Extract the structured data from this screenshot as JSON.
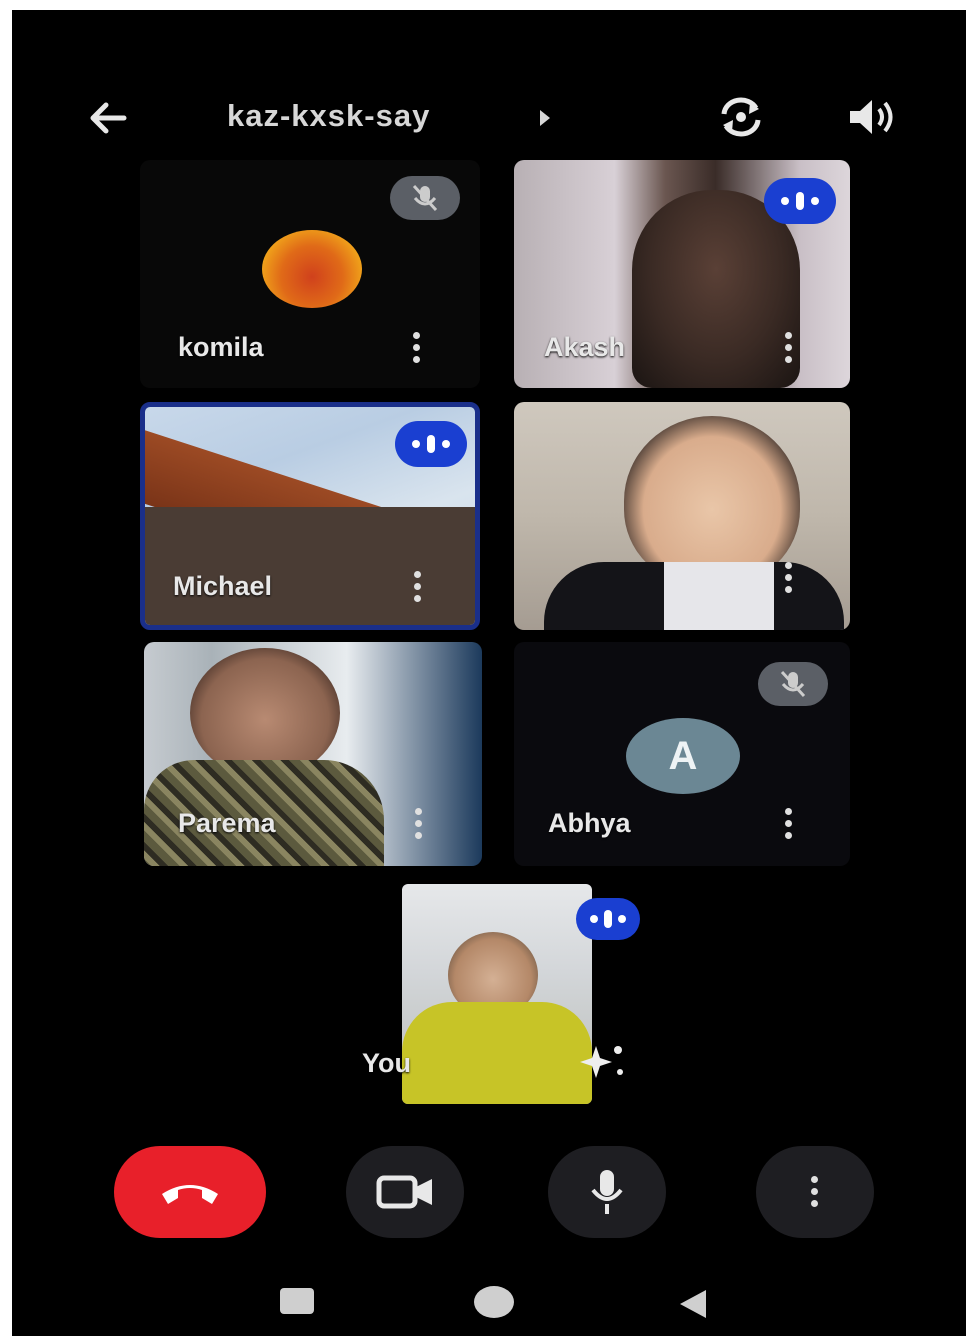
{
  "meeting": {
    "code": "kaz-kxsk-say"
  },
  "icons": {
    "back": "arrow-left-icon",
    "code_dropdown": "caret-right-icon",
    "flip_camera": "flip-camera-icon",
    "speaker": "speaker-volume-icon",
    "muted": "mic-off-icon",
    "speaking": "audio-activity-icon",
    "more": "more-vertical-icon",
    "effects": "sparkle-effects-icon",
    "end_call": "phone-hangup-icon",
    "camera": "video-camera-icon",
    "microphone": "microphone-icon",
    "nav_recents": "recents-icon",
    "nav_home": "home-icon",
    "nav_back": "back-triangle-icon"
  },
  "participants": [
    {
      "name": "komila",
      "video": false,
      "muted": true,
      "speaking": false
    },
    {
      "name": "Akash",
      "video": true,
      "muted": false,
      "speaking": true
    },
    {
      "name": "Michael",
      "video": true,
      "muted": false,
      "speaking": true
    },
    {
      "name": "",
      "video": true,
      "muted": false,
      "speaking": false
    },
    {
      "name": "Parema",
      "video": true,
      "muted": false,
      "speaking": false
    },
    {
      "name": "Abhya",
      "video": false,
      "muted": true,
      "speaking": false,
      "avatar_letter": "A"
    },
    {
      "name": "You",
      "video": true,
      "muted": false,
      "speaking": true
    }
  ],
  "colors": {
    "background": "#000000",
    "end_call": "#e8202a",
    "speaking_badge": "#1a3fd1",
    "active_speaker_border": "#1a2f8a",
    "avatar": "#6b8794"
  }
}
